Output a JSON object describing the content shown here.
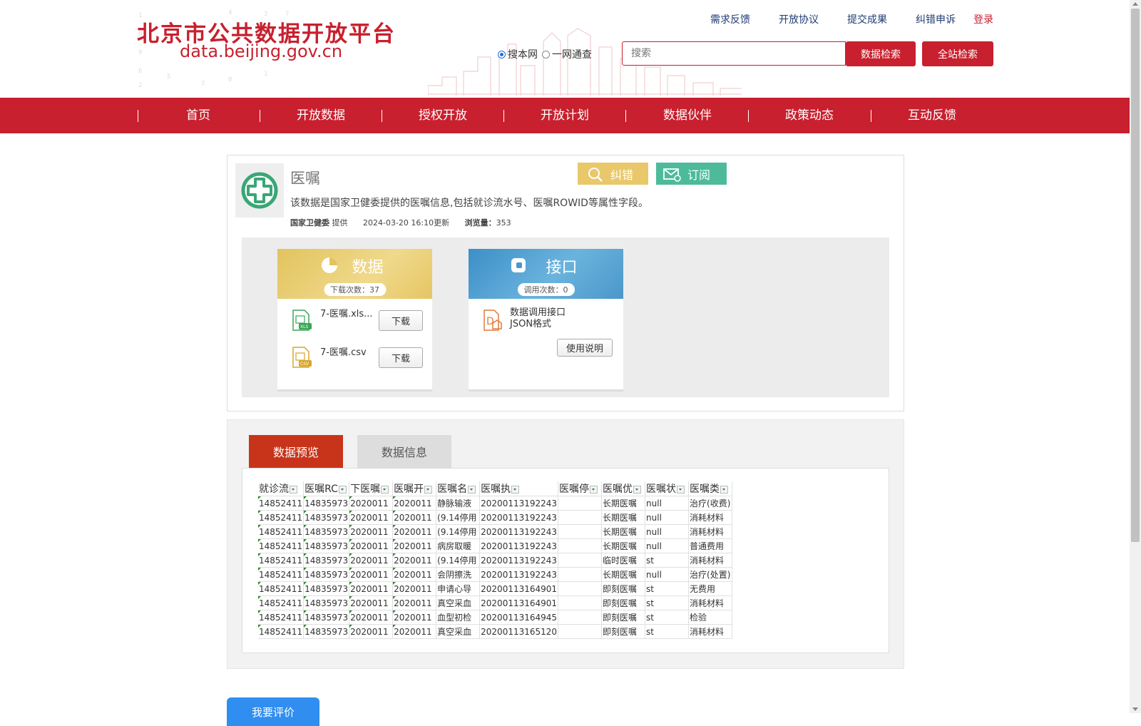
{
  "site": {
    "logo_cn": "北京市公共数据开放平台",
    "logo_en": "data.beijing.gov.cn"
  },
  "top_links": [
    "需求反馈",
    "开放协议",
    "提交成果",
    "纠错申诉"
  ],
  "login": "登录",
  "search": {
    "radio_options": [
      {
        "label": "搜本网",
        "checked": true
      },
      {
        "label": "一网通查",
        "checked": false
      }
    ],
    "placeholder": "搜索",
    "btn_data_search": "数据检索",
    "btn_site_search": "全站检索"
  },
  "nav": [
    "首页",
    "开放数据",
    "授权开放",
    "开放计划",
    "数据伙伴",
    "政策动态",
    "互动反馈"
  ],
  "dataset": {
    "title": "医嘱",
    "btn_correct": "纠错",
    "btn_subscribe": "订阅",
    "description": "该数据是国家卫健委提供的医嘱信息,包括就诊流水号、医嘱ROWID等属性字段。",
    "provider": "国家卫健委",
    "provider_suffix": " 提供",
    "updated": "2024-03-20 16:10更新",
    "views_label": "浏览量：",
    "views": "353"
  },
  "data_panel": {
    "title": "数据",
    "count_label": "下载次数：37",
    "files": [
      {
        "name": "7-医嘱.xls...",
        "type": "XLS",
        "button": "下载"
      },
      {
        "name": "7-医嘱.csv",
        "type": "CSV",
        "button": "下载"
      }
    ]
  },
  "api_panel": {
    "title": "接口",
    "count_label": "调用次数：0",
    "line1": "数据调用接口",
    "line2": "JSON格式",
    "button": "使用说明"
  },
  "tabs": {
    "active": "数据预览",
    "other": "数据信息"
  },
  "sheet": {
    "headers": [
      "就诊流",
      "医嘱RC",
      "下医嘱",
      "医嘱开",
      "医嘱名",
      "医嘱执",
      "医嘱停",
      "医嘱优",
      "医嘱状",
      "医嘱类"
    ],
    "rows": [
      [
        "14852411",
        "14835973",
        "2020011",
        "2020011",
        "静脉输液",
        "20200113192243",
        "",
        "长期医嘱",
        "null",
        "治疗(收费)"
      ],
      [
        "14852411",
        "14835973",
        "2020011",
        "2020011",
        "(9.14停用",
        "20200113192243",
        "",
        "长期医嘱",
        "null",
        "消耗材料"
      ],
      [
        "14852411",
        "14835973",
        "2020011",
        "2020011",
        "(9.14停用",
        "20200113192243",
        "",
        "长期医嘱",
        "null",
        "消耗材料"
      ],
      [
        "14852411",
        "14835973",
        "2020011",
        "2020011",
        "病房取暖",
        "20200113192243",
        "",
        "长期医嘱",
        "null",
        "普通费用"
      ],
      [
        "14852411",
        "14835973",
        "2020011",
        "2020011",
        "(9.14停用",
        "20200113192243",
        "",
        "临时医嘱",
        "st",
        "消耗材料"
      ],
      [
        "14852411",
        "14835973",
        "2020011",
        "2020011",
        "会阴擦洗",
        "20200113192243",
        "",
        "长期医嘱",
        "null",
        "治疗(处置)"
      ],
      [
        "14852411",
        "14835973",
        "2020011",
        "2020011",
        "申请心导",
        "20200113164901",
        "",
        "即刻医嘱",
        "st",
        "无费用"
      ],
      [
        "14852411",
        "14835973",
        "2020011",
        "2020011",
        "真空采血",
        "20200113164901",
        "",
        "即刻医嘱",
        "st",
        "消耗材料"
      ],
      [
        "14852411",
        "14835973",
        "2020011",
        "2020011",
        "血型初检",
        "20200113164945",
        "",
        "即刻医嘱",
        "st",
        "检验"
      ],
      [
        "14852411",
        "14835973",
        "2020011",
        "2020011",
        "真空采血",
        "20200113165120",
        "",
        "即刻医嘱",
        "st",
        "消耗材料"
      ]
    ]
  },
  "rate_button": "我要评价",
  "colors": {
    "brand_red": "#c8202e",
    "tab_active": "#c8341a",
    "correct_btn": "#e8c86a",
    "subscribe_btn": "#4dbb9a",
    "rate_btn": "#2f8ef0"
  }
}
